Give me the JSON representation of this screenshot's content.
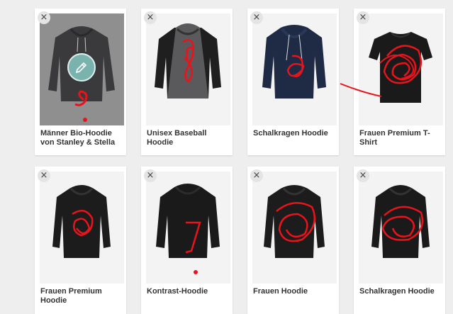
{
  "products": [
    {
      "name": "Männer Bio-Hoodie von Stanley & Stella",
      "style": "hoodie",
      "color": "#3a3a3c",
      "selected": true
    },
    {
      "name": "Unisex Baseball Hoodie",
      "style": "baseball",
      "color": "#1f1f1f"
    },
    {
      "name": "Schalkragen Hoodie",
      "style": "hoodie",
      "color": "#1f2a44"
    },
    {
      "name": "Frauen Premium T-Shirt",
      "style": "tshirt",
      "color": "#1a1a1a"
    },
    {
      "name": "Frauen Premium Hoodie",
      "style": "hoodie",
      "color": "#1c1c1c"
    },
    {
      "name": "Kontrast-Hoodie",
      "style": "hoodie",
      "color": "#1a1a1a"
    },
    {
      "name": "Frauen Hoodie",
      "style": "hoodie",
      "color": "#1c1c1c"
    },
    {
      "name": "Schalkragen Hoodie",
      "style": "hoodie",
      "color": "#1a1a1a"
    }
  ],
  "close_label": "×",
  "icons": {
    "close": "close-icon",
    "edit": "pencil-icon"
  },
  "colors": {
    "scribble": "#e8141c",
    "edit_button": "#7ab3ad"
  }
}
